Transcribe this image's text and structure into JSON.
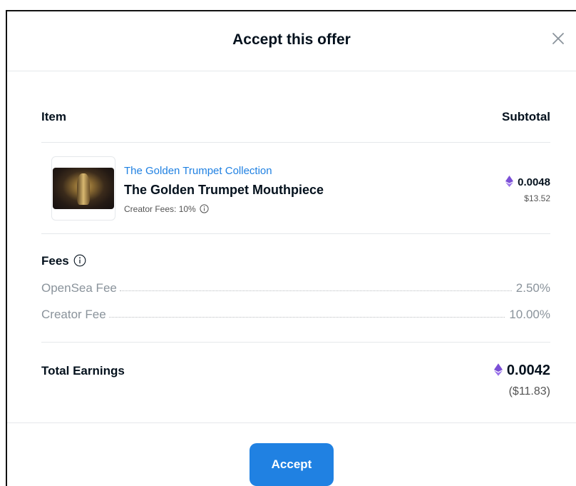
{
  "modal": {
    "title": "Accept this offer"
  },
  "table": {
    "item_header": "Item",
    "subtotal_header": "Subtotal"
  },
  "item": {
    "collection": "The Golden Trumpet Collection",
    "name": "The Golden Trumpet Mouthpiece",
    "creator_fees": "Creator Fees: 10%",
    "price_eth": "0.0048",
    "price_usd": "$13.52"
  },
  "fees": {
    "title": "Fees",
    "rows": [
      {
        "label": "OpenSea Fee",
        "value": "2.50%"
      },
      {
        "label": "Creator Fee",
        "value": "10.00%"
      }
    ]
  },
  "total": {
    "label": "Total Earnings",
    "eth": "0.0042",
    "usd": "($11.83)"
  },
  "footer": {
    "accept_label": "Accept"
  },
  "icons": {
    "close": "close-icon",
    "info": "info-icon",
    "eth": "ethereum-icon"
  },
  "colors": {
    "accent": "#2081e2",
    "eth": "#7b4fd6",
    "muted": "#8a939b"
  }
}
